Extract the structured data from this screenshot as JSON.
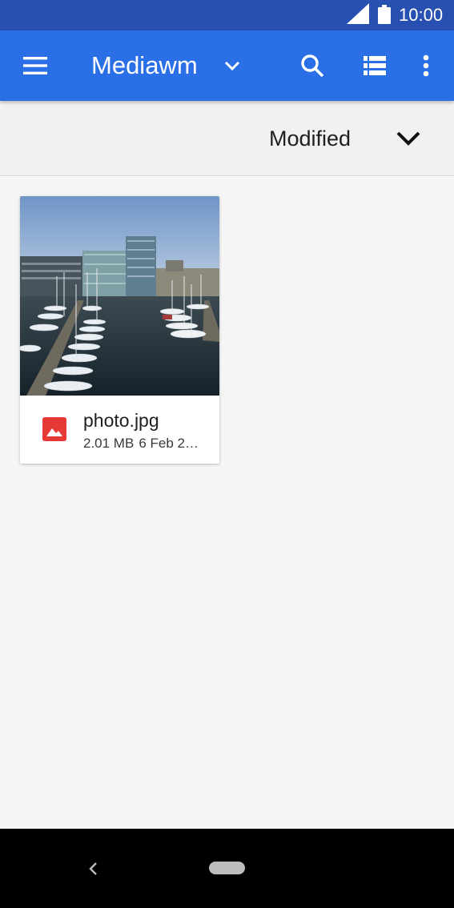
{
  "status_bar": {
    "time": "10:00",
    "signal_icon": "signal-full-icon",
    "battery_icon": "battery-full-icon"
  },
  "app_bar": {
    "title": "Mediawm",
    "icons": {
      "menu": "hamburger-menu-icon",
      "title_dropdown": "chevron-down-icon",
      "search": "search-icon",
      "view_toggle": "list-view-icon",
      "more": "more-vert-icon"
    },
    "background": "#2a6fe6",
    "status_background": "#2850b0"
  },
  "sort_bar": {
    "label": "Modified",
    "icon": "chevron-down-icon"
  },
  "files": [
    {
      "name": "photo.jpg",
      "size": "2.01 MB",
      "date": "6 Feb 2…",
      "type_icon": "image-file-icon",
      "type_icon_color": "#e53935"
    }
  ],
  "nav_bar": {
    "back_icon": "back-arrow-icon",
    "home_icon": "home-pill-icon"
  }
}
